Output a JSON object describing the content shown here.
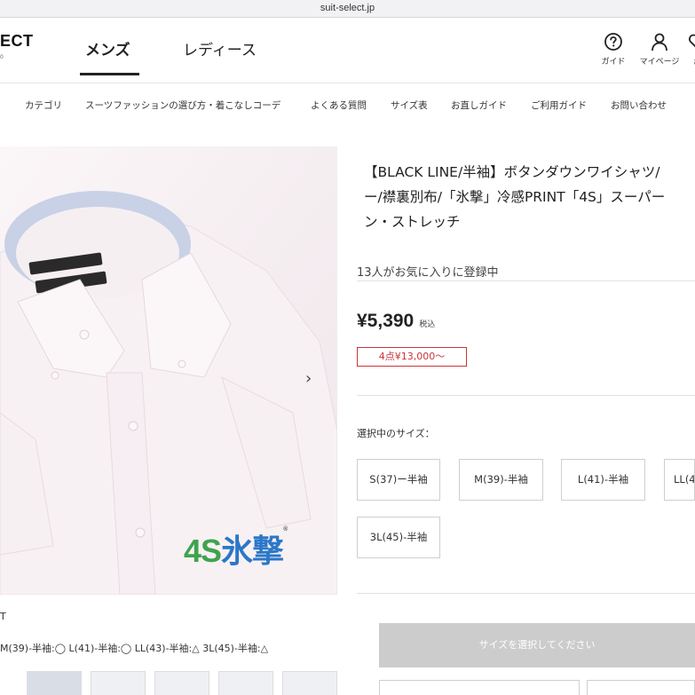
{
  "browser": {
    "url": "suit-select.jp"
  },
  "header": {
    "logo": "ECT",
    "logo_sub": "0",
    "tabs": {
      "men": "メンズ",
      "ladies": "レディース"
    },
    "icons": [
      {
        "name": "guide",
        "label": "ガイド"
      },
      {
        "name": "mypage",
        "label": "マイページ"
      },
      {
        "name": "extra",
        "label": "ぉ"
      }
    ]
  },
  "subnav": [
    "カテゴリ",
    "スーツファッションの選び方・着こなしコーデ",
    "よくある質問",
    "サイズ表",
    "お直しガイド",
    "ご利用ガイド",
    "お問い合わせ"
  ],
  "product": {
    "title_lines": [
      "【BLACK LINE/半袖】ボタンダウンワイシャツ/",
      "ー/襟裏別布/「氷撃」冷感PRINT「4S」スーパー",
      "ン・ストレッチ"
    ],
    "favorites": "13人がお気に入りに登録中",
    "price": "¥5,390",
    "tax_label": "税込",
    "promo": "4点¥13,000〜",
    "size_label": "選択中のサイズ：",
    "sizes": [
      "S(37)ー半袖",
      "M(39)-半袖",
      "L(41)-半袖",
      "LL(4",
      "3L(45)-半袖"
    ],
    "cta": "サイズを選択してください",
    "image_logo": {
      "a": "4S",
      "b": "氷撃",
      "mark": "®"
    },
    "next_arrow": "›",
    "caption": "T",
    "stock_line": "M(39)-半袖:◯ L(41)-半袖:◯ LL(43)-半袖:△ 3L(45)-半袖:△"
  },
  "colors": {
    "promo_red": "#c9343a",
    "cta_gray": "#cccccc",
    "logo_green": "#3fa34d",
    "logo_blue": "#2b77c8"
  }
}
